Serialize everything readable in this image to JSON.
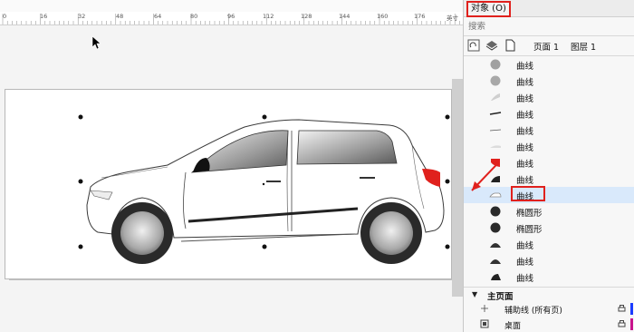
{
  "ruler": {
    "labels": [
      "0",
      "16",
      "32",
      "48",
      "64",
      "80",
      "96",
      "112",
      "128",
      "144",
      "160",
      "176"
    ],
    "unit": "英寸"
  },
  "panel": {
    "title": "对象 (O)",
    "search_placeholder": "搜索",
    "page_label": "页面 1",
    "layer_label": "图层 1",
    "objects": [
      {
        "label": "曲线",
        "icon": "gray-circle-icon"
      },
      {
        "label": "曲线",
        "icon": "gray-circle-icon"
      },
      {
        "label": "曲线",
        "icon": "light-curve-icon"
      },
      {
        "label": "曲线",
        "icon": "dark-line-icon"
      },
      {
        "label": "曲线",
        "icon": "thin-line-icon"
      },
      {
        "label": "曲线",
        "icon": "light-shape-icon"
      },
      {
        "label": "曲线",
        "icon": "red-shape-icon"
      },
      {
        "label": "曲线",
        "icon": "dark-wedge-icon"
      },
      {
        "label": "曲线",
        "icon": "car-outline-icon",
        "selected": true
      },
      {
        "label": "椭圆形",
        "icon": "black-ellipse-icon"
      },
      {
        "label": "椭圆形",
        "icon": "black-ellipse-icon"
      },
      {
        "label": "曲线",
        "icon": "dark-dome-icon"
      },
      {
        "label": "曲线",
        "icon": "dark-dome-icon"
      },
      {
        "label": "曲线",
        "icon": "dark-wedge-icon"
      }
    ],
    "master_section": {
      "label": "主页面",
      "items": [
        {
          "label": "辅助线 (所有页)",
          "icon": "guideline-icon",
          "swatch": "#1a3cff"
        },
        {
          "label": "桌面",
          "icon": "desktop-icon",
          "swatch": "#c8148c"
        }
      ]
    }
  },
  "colors": {
    "highlight_red": "#e0211d",
    "selection_blue": "#d9e9fb"
  }
}
